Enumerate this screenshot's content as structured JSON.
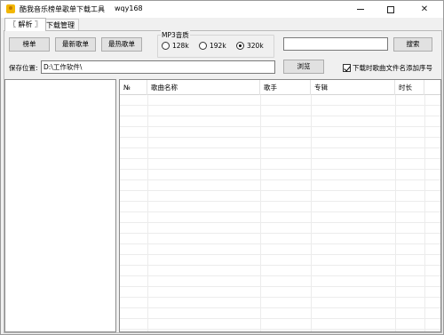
{
  "window": {
    "title": "酷我音乐榜单歌单下载工具",
    "subtitle": "wqy168",
    "minimize": "—",
    "close": "✕"
  },
  "tabs": [
    {
      "label": "〖 解析 〗"
    },
    {
      "label": "下载管理"
    }
  ],
  "toolbar": {
    "chart_button": "榜单",
    "newest_button": "最新歌单",
    "hottest_button": "最热歌单",
    "quality_group": "MP3音质",
    "quality_options": [
      {
        "label": "128k",
        "selected": false
      },
      {
        "label": "192k",
        "selected": false
      },
      {
        "label": "320k",
        "selected": true
      }
    ],
    "search_value": "",
    "search_button": "搜索"
  },
  "save": {
    "label": "保存位置:",
    "path": "D:\\工作软件\\",
    "browse_button": "浏览",
    "add_index_label": "下载时歌曲文件名添加序号",
    "add_index_checked": true
  },
  "table": {
    "columns": [
      "№",
      "歌曲名称",
      "歌手",
      "专辑",
      "时长"
    ],
    "rows": []
  }
}
